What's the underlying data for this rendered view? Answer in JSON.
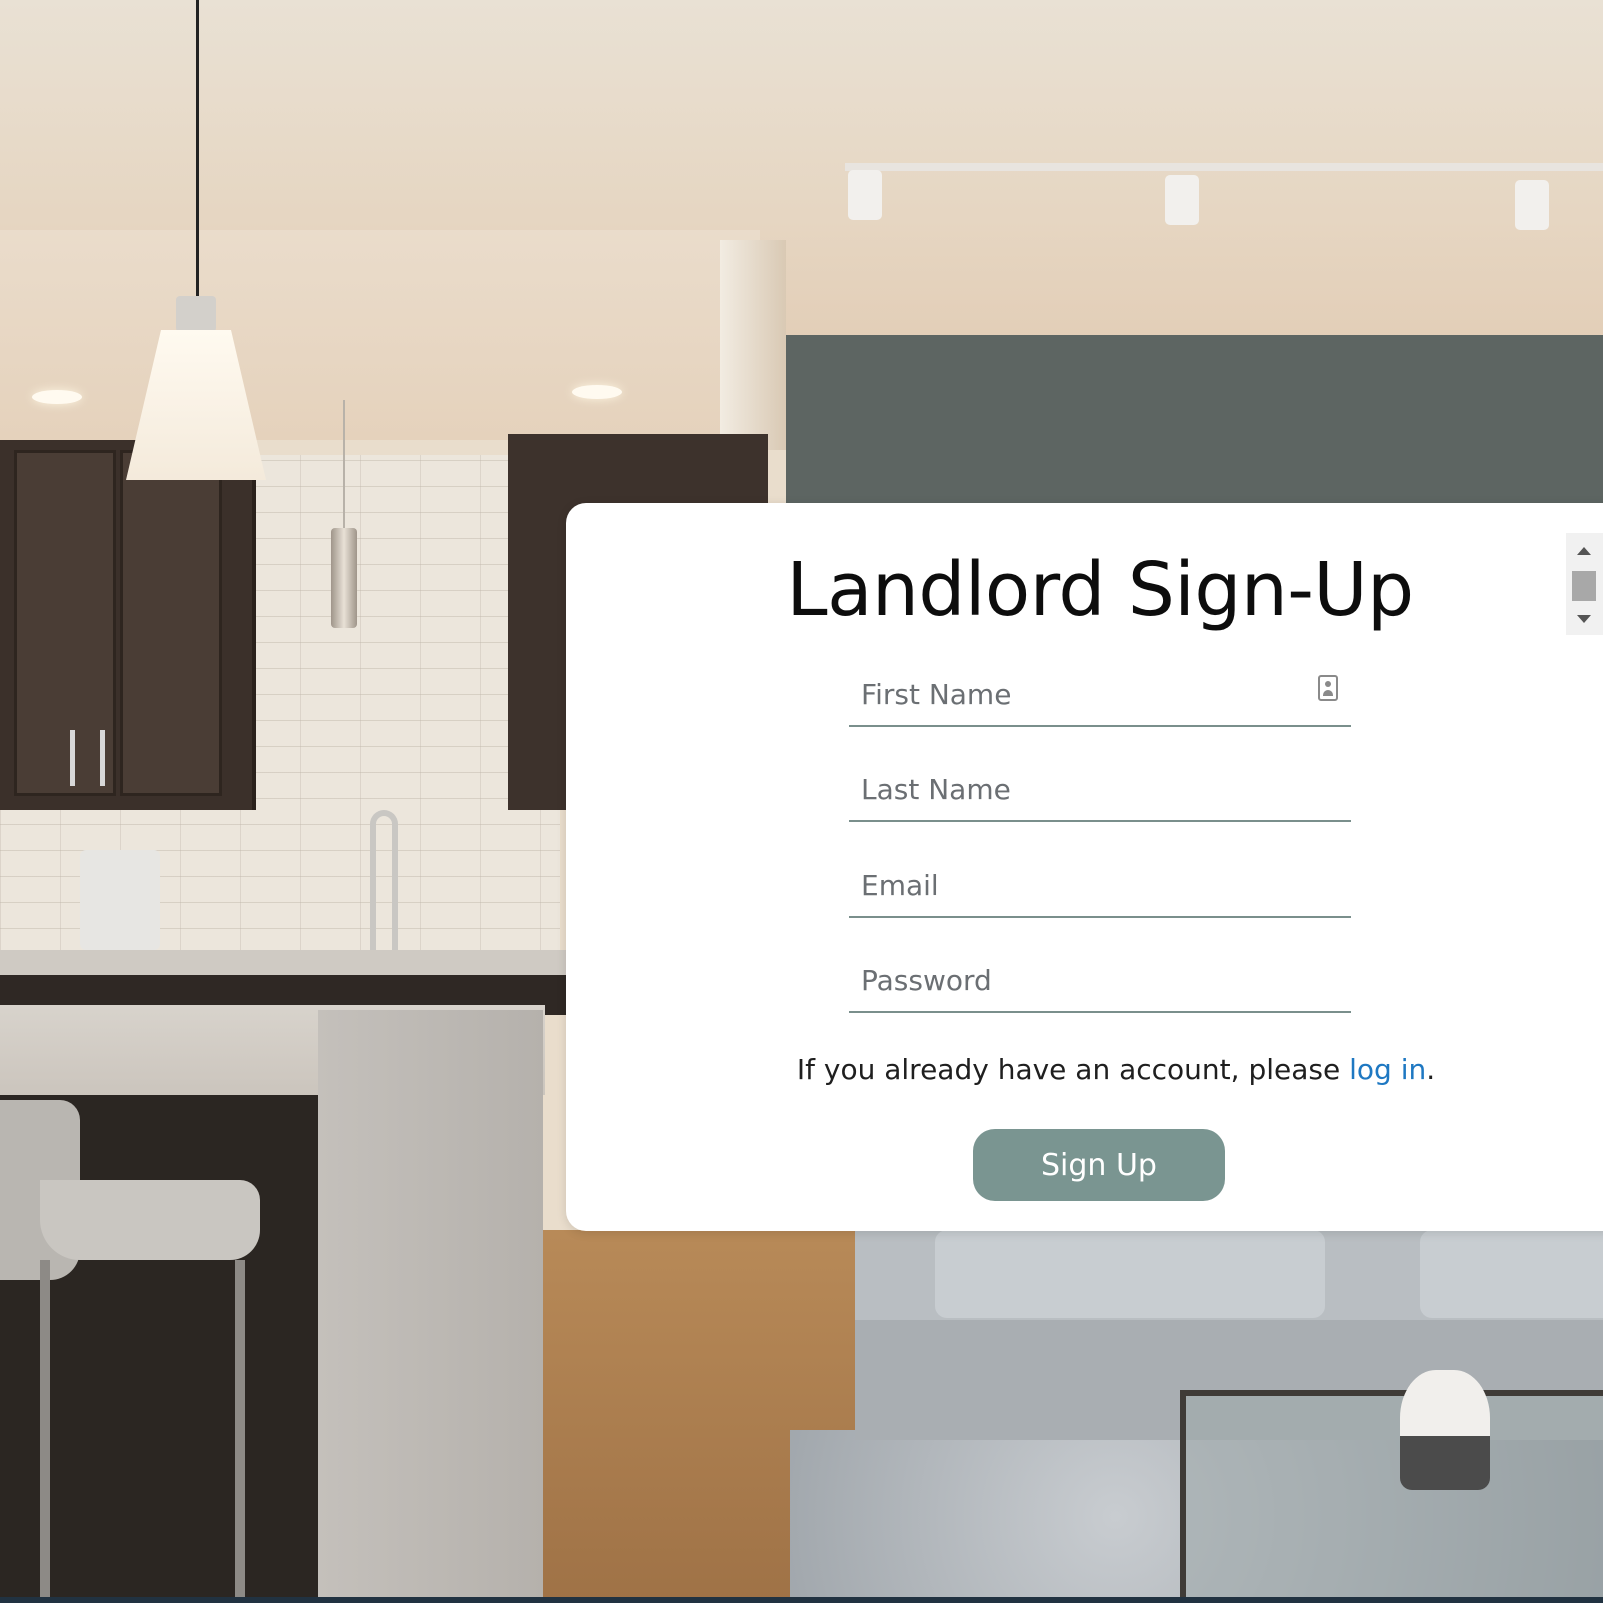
{
  "page": {
    "title": "Landlord Sign-Up",
    "accent_color": "#7a9591",
    "link_color": "#1e78c2"
  },
  "form": {
    "first_name": {
      "placeholder": "First Name",
      "value": ""
    },
    "last_name": {
      "placeholder": "Last Name",
      "value": ""
    },
    "email": {
      "placeholder": "Email",
      "value": ""
    },
    "password": {
      "placeholder": "Password",
      "value": ""
    },
    "login_prompt_prefix": "If you already have an account, please ",
    "login_link": "log in",
    "login_prompt_suffix": ".",
    "submit_label": "Sign Up"
  },
  "icons": {
    "autofill": "contact-card-icon"
  },
  "background": {
    "scene": "modern kitchen and living room photo"
  }
}
